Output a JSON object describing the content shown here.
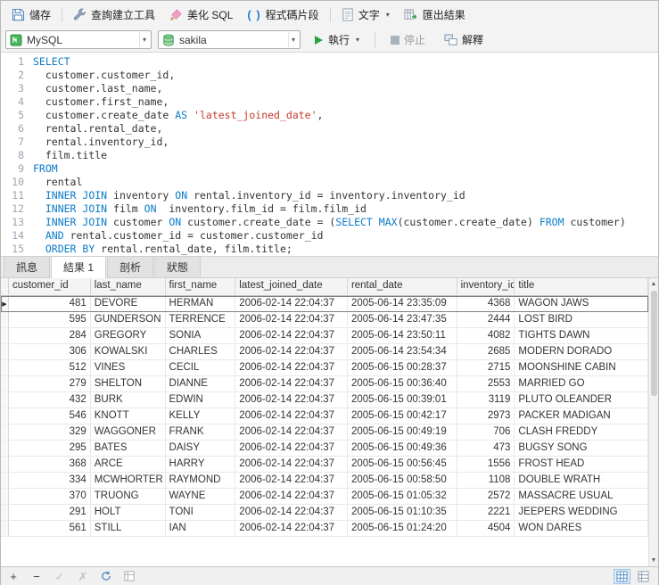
{
  "toolbar": {
    "save": "儲存",
    "query_builder": "查詢建立工具",
    "beautify_sql": "美化 SQL",
    "code_snippet": "程式碼片段",
    "text": "文字",
    "export_result": "匯出結果"
  },
  "connection_bar": {
    "connection": "MySQL",
    "database": "sakila",
    "run": "執行",
    "stop": "停止",
    "explain": "解釋"
  },
  "icons": {
    "code_snippet": "( )",
    "dropdown": "▾",
    "row_marker": "▶",
    "plus": "+",
    "minus": "−",
    "check": "✓",
    "cross": "✗",
    "scroll_up": "▲",
    "scroll_down": "▼"
  },
  "editor": {
    "lines": [
      {
        "tokens": [
          [
            "k",
            "SELECT"
          ]
        ]
      },
      {
        "tokens": [
          [
            "p",
            "  customer.customer_id,"
          ]
        ]
      },
      {
        "tokens": [
          [
            "p",
            "  customer.last_name,"
          ]
        ]
      },
      {
        "tokens": [
          [
            "p",
            "  customer.first_name,"
          ]
        ]
      },
      {
        "tokens": [
          [
            "p",
            "  customer.create_date "
          ],
          [
            "k",
            "AS"
          ],
          [
            "p",
            " "
          ],
          [
            "s",
            "'latest_joined_date'"
          ],
          [
            "p",
            ","
          ]
        ]
      },
      {
        "tokens": [
          [
            "p",
            "  rental.rental_date,"
          ]
        ]
      },
      {
        "tokens": [
          [
            "p",
            "  rental.inventory_id,"
          ]
        ]
      },
      {
        "tokens": [
          [
            "p",
            "  film.title"
          ]
        ]
      },
      {
        "tokens": [
          [
            "k",
            "FROM"
          ]
        ]
      },
      {
        "tokens": [
          [
            "p",
            "  rental"
          ]
        ]
      },
      {
        "tokens": [
          [
            "p",
            "  "
          ],
          [
            "k",
            "INNER JOIN"
          ],
          [
            "p",
            " inventory "
          ],
          [
            "k",
            "ON"
          ],
          [
            "p",
            " rental.inventory_id = inventory.inventory_id"
          ]
        ]
      },
      {
        "tokens": [
          [
            "p",
            "  "
          ],
          [
            "k",
            "INNER JOIN"
          ],
          [
            "p",
            " film "
          ],
          [
            "k",
            "ON"
          ],
          [
            "p",
            "  inventory.film_id = film.film_id"
          ]
        ]
      },
      {
        "tokens": [
          [
            "p",
            "  "
          ],
          [
            "k",
            "INNER JOIN"
          ],
          [
            "p",
            " customer "
          ],
          [
            "k",
            "ON"
          ],
          [
            "p",
            " customer.create_date = ("
          ],
          [
            "k",
            "SELECT"
          ],
          [
            "p",
            " "
          ],
          [
            "k",
            "MAX"
          ],
          [
            "p",
            "(customer.create_date) "
          ],
          [
            "k",
            "FROM"
          ],
          [
            "p",
            " customer)"
          ]
        ]
      },
      {
        "tokens": [
          [
            "p",
            "  "
          ],
          [
            "k",
            "AND"
          ],
          [
            "p",
            " rental.customer_id = customer.customer_id"
          ]
        ]
      },
      {
        "tokens": [
          [
            "p",
            "  "
          ],
          [
            "k",
            "ORDER BY"
          ],
          [
            "p",
            " rental.rental_date, film.title;"
          ]
        ]
      }
    ]
  },
  "result_tabs": [
    {
      "label": "訊息",
      "active": false
    },
    {
      "label": "結果 1",
      "active": true
    },
    {
      "label": "剖析",
      "active": false
    },
    {
      "label": "狀態",
      "active": false
    }
  ],
  "grid": {
    "columns": [
      "customer_id",
      "last_name",
      "first_name",
      "latest_joined_date",
      "rental_date",
      "inventory_id",
      "title"
    ],
    "selected_row": 0,
    "rows": [
      [
        481,
        "DEVORE",
        "HERMAN",
        "2006-02-14 22:04:37",
        "2005-06-14 23:35:09",
        4368,
        "WAGON JAWS"
      ],
      [
        595,
        "GUNDERSON",
        "TERRENCE",
        "2006-02-14 22:04:37",
        "2005-06-14 23:47:35",
        2444,
        "LOST BIRD"
      ],
      [
        284,
        "GREGORY",
        "SONIA",
        "2006-02-14 22:04:37",
        "2005-06-14 23:50:11",
        4082,
        "TIGHTS DAWN"
      ],
      [
        306,
        "KOWALSKI",
        "CHARLES",
        "2006-02-14 22:04:37",
        "2005-06-14 23:54:34",
        2685,
        "MODERN DORADO"
      ],
      [
        512,
        "VINES",
        "CECIL",
        "2006-02-14 22:04:37",
        "2005-06-15 00:28:37",
        2715,
        "MOONSHINE CABIN"
      ],
      [
        279,
        "SHELTON",
        "DIANNE",
        "2006-02-14 22:04:37",
        "2005-06-15 00:36:40",
        2553,
        "MARRIED GO"
      ],
      [
        432,
        "BURK",
        "EDWIN",
        "2006-02-14 22:04:37",
        "2005-06-15 00:39:01",
        3119,
        "PLUTO OLEANDER"
      ],
      [
        546,
        "KNOTT",
        "KELLY",
        "2006-02-14 22:04:37",
        "2005-06-15 00:42:17",
        2973,
        "PACKER MADIGAN"
      ],
      [
        329,
        "WAGGONER",
        "FRANK",
        "2006-02-14 22:04:37",
        "2005-06-15 00:49:19",
        706,
        "CLASH FREDDY"
      ],
      [
        295,
        "BATES",
        "DAISY",
        "2006-02-14 22:04:37",
        "2005-06-15 00:49:36",
        473,
        "BUGSY SONG"
      ],
      [
        368,
        "ARCE",
        "HARRY",
        "2006-02-14 22:04:37",
        "2005-06-15 00:56:45",
        1556,
        "FROST HEAD"
      ],
      [
        334,
        "MCWHORTER",
        "RAYMOND",
        "2006-02-14 22:04:37",
        "2005-06-15 00:58:50",
        1108,
        "DOUBLE WRATH"
      ],
      [
        370,
        "TRUONG",
        "WAYNE",
        "2006-02-14 22:04:37",
        "2005-06-15 01:05:32",
        2572,
        "MASSACRE USUAL"
      ],
      [
        291,
        "HOLT",
        "TONI",
        "2006-02-14 22:04:37",
        "2005-06-15 01:10:35",
        2221,
        "JEEPERS WEDDING"
      ],
      [
        561,
        "STILL",
        "IAN",
        "2006-02-14 22:04:37",
        "2005-06-15 01:24:20",
        4504,
        "WON DARES"
      ]
    ]
  }
}
